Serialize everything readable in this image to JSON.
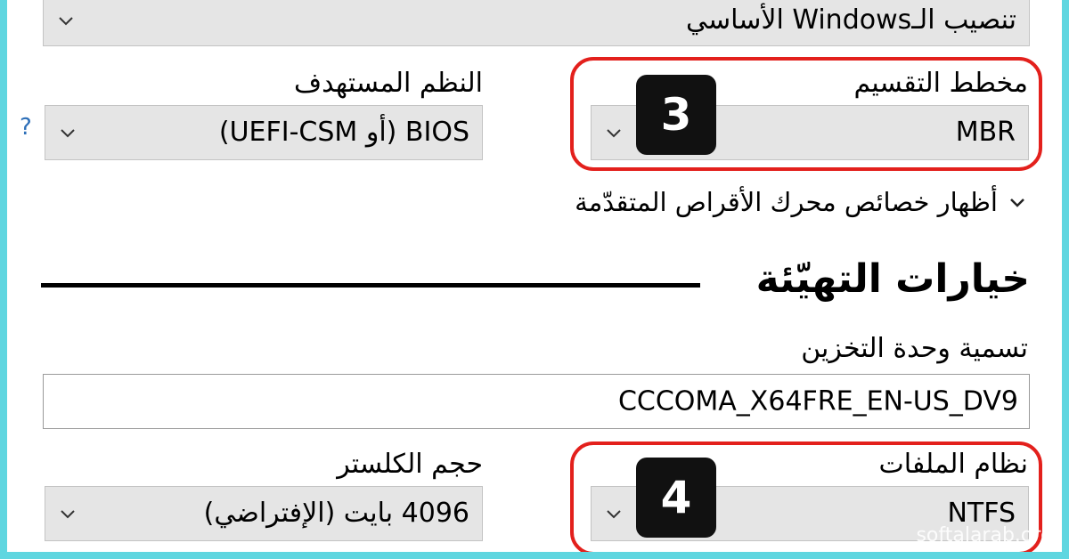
{
  "top_select": {
    "value": "تنصيب الـWindows الأساسي"
  },
  "partition_scheme": {
    "label": "مخطط التقسيم",
    "value": "MBR",
    "badge": "3"
  },
  "target_system": {
    "label": "النظم المستهدف",
    "value": "BIOS (أو UEFI-CSM)",
    "help": "?"
  },
  "advanced_drive": {
    "label": "أظهار خصائص محرك الأقراص المتقدّمة"
  },
  "format_section": {
    "title": "خيارات التهيّئة"
  },
  "volume_label": {
    "label": "تسمية وحدة التخزين",
    "value": "CCCOMA_X64FRE_EN-US_DV9"
  },
  "file_system": {
    "label": "نظام الملفات",
    "value": "NTFS",
    "badge": "4"
  },
  "cluster_size": {
    "label": "حجم الكلستر",
    "value": "4096 بايت (الإفتراضي)"
  },
  "watermark": "softalarab.org",
  "colors": {
    "highlight": "#e3201c",
    "frame": "#5fd6e0",
    "select_bg": "#e5e5e5"
  }
}
